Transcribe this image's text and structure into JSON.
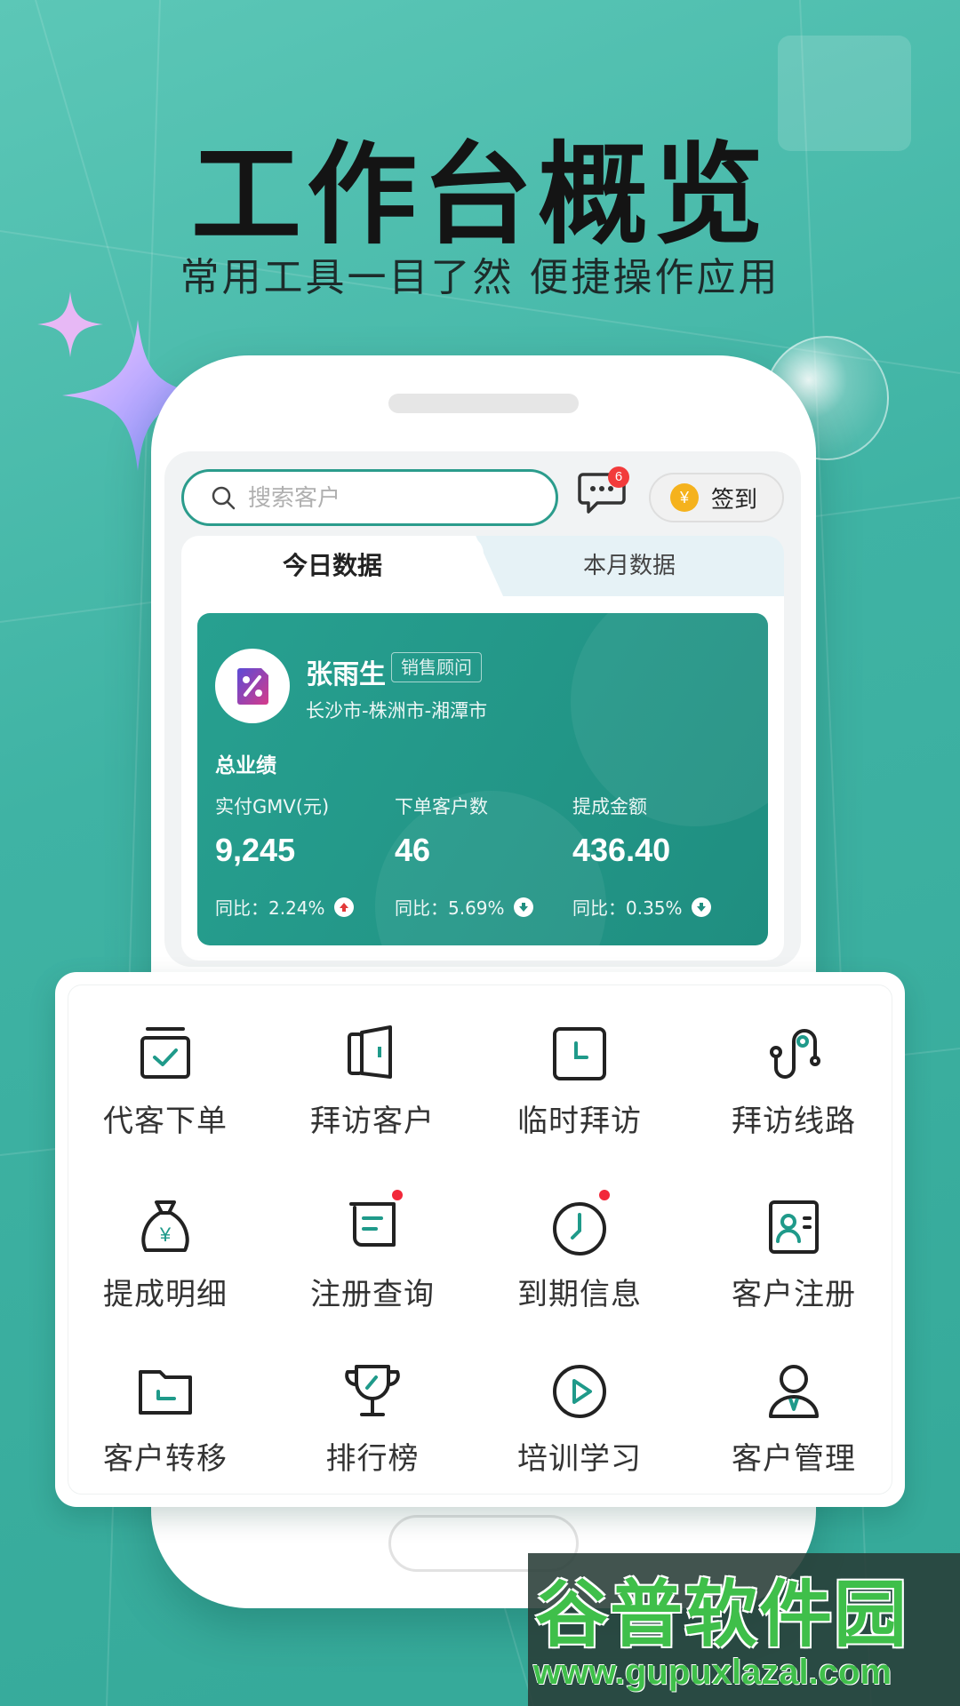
{
  "hero": {
    "title": "工作台概览",
    "subtitle": "常用工具一目了然 便捷操作应用"
  },
  "header": {
    "search_placeholder": "搜索客户",
    "message_badge": "6",
    "signin_label": "签到",
    "coin_symbol": "¥"
  },
  "tabs": [
    {
      "label": "今日数据",
      "active": true
    },
    {
      "label": "本月数据",
      "active": false
    }
  ],
  "profile": {
    "name": "张雨生",
    "role": "销售顾问",
    "region": "长沙市-株洲市-湘潭市",
    "summary_label": "总业绩"
  },
  "stats": [
    {
      "label": "实付GMV(元)",
      "value": "9,245",
      "yoy": "同比：2.24%",
      "trend": "up"
    },
    {
      "label": "下单客户数",
      "value": "46",
      "yoy": "同比：5.69%",
      "trend": "down"
    },
    {
      "label": "提成金额",
      "value": "436.40",
      "yoy": "同比：0.35%",
      "trend": "down"
    }
  ],
  "tools": [
    {
      "label": "代客下单",
      "icon": "order-check-icon",
      "dot": false
    },
    {
      "label": "拜访客户",
      "icon": "door-icon",
      "dot": false
    },
    {
      "label": "临时拜访",
      "icon": "clock-square-icon",
      "dot": false
    },
    {
      "label": "拜访线路",
      "icon": "route-icon",
      "dot": false
    },
    {
      "label": "提成明细",
      "icon": "money-bag-icon",
      "dot": false
    },
    {
      "label": "注册查询",
      "icon": "scroll-icon",
      "dot": true
    },
    {
      "label": "到期信息",
      "icon": "clock-icon",
      "dot": true
    },
    {
      "label": "客户注册",
      "icon": "contact-card-icon",
      "dot": false
    },
    {
      "label": "客户转移",
      "icon": "folder-transfer-icon",
      "dot": false
    },
    {
      "label": "排行榜",
      "icon": "trophy-icon",
      "dot": false
    },
    {
      "label": "培训学习",
      "icon": "play-icon",
      "dot": false
    },
    {
      "label": "客户管理",
      "icon": "user-icon",
      "dot": false
    }
  ],
  "watermark": {
    "title": "谷普软件园",
    "url": "www.gupuxlazal.com"
  },
  "colors": {
    "accent": "#2b9c8c",
    "card": "#1f8e80",
    "badge": "#f23b3b",
    "coin": "#f5b21d"
  }
}
